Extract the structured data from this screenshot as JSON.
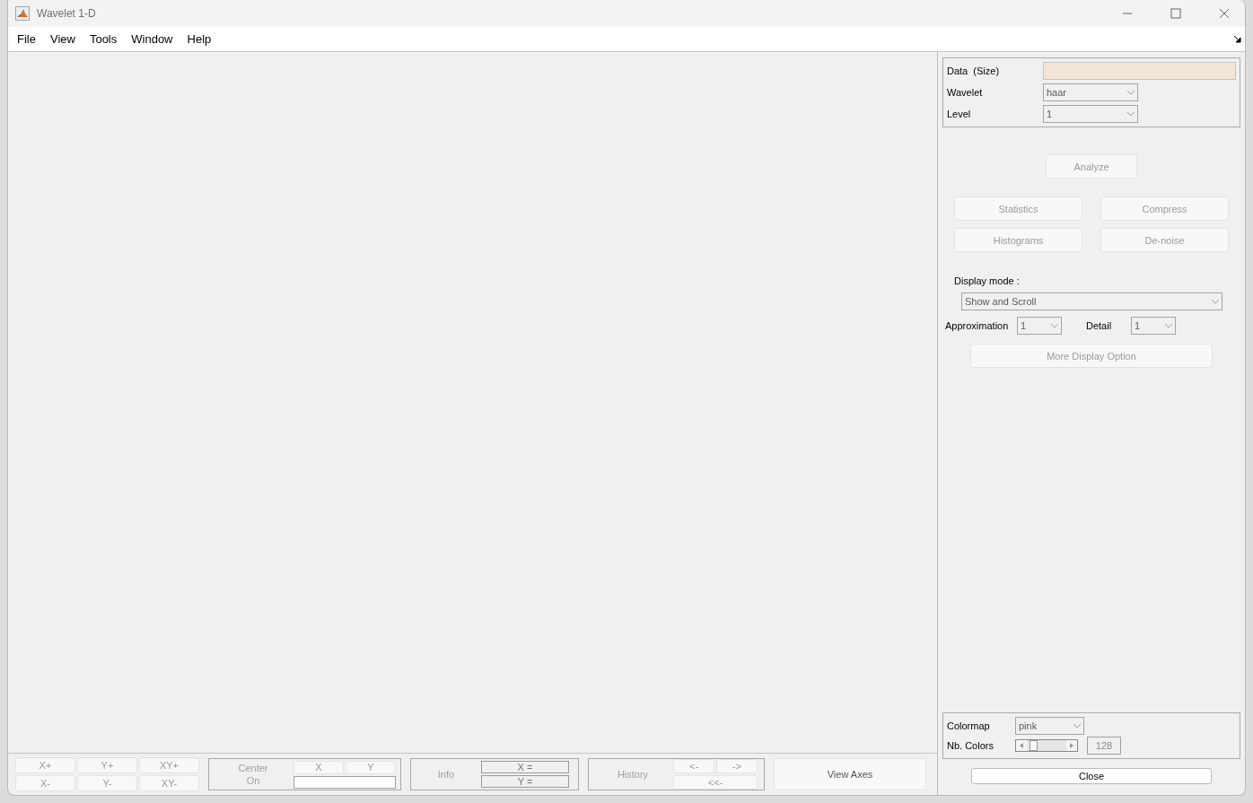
{
  "window": {
    "title": "Wavelet 1-D"
  },
  "menu": [
    "File",
    "View",
    "Tools",
    "Window",
    "Help"
  ],
  "params": {
    "data_label": "Data  (Size)",
    "wavelet_label": "Wavelet",
    "wavelet_value": "haar",
    "level_label": "Level",
    "level_value": "1"
  },
  "analyze": {
    "label": "Analyze",
    "disabled": true
  },
  "tools": [
    {
      "label": "Statistics",
      "disabled": true
    },
    {
      "label": "Compress",
      "disabled": true
    },
    {
      "label": "Histograms",
      "disabled": true
    },
    {
      "label": "De-noise",
      "disabled": true
    }
  ],
  "display": {
    "label": "Display mode :",
    "mode": "Show and Scroll",
    "approx_label": "Approximation",
    "approx_value": "1",
    "detail_label": "Detail",
    "detail_value": "1",
    "more": {
      "label": "More Display Option",
      "disabled": true
    }
  },
  "colormap": {
    "label": "Colormap",
    "value": "pink",
    "nb_label": "Nb. Colors",
    "level": 0.08,
    "count": "128"
  },
  "close": {
    "label": "Close",
    "disabled": false
  },
  "zoom_buttons": [
    {
      "label": "X+",
      "disabled": true
    },
    {
      "label": "Y+",
      "disabled": true
    },
    {
      "label": "XY+",
      "disabled": true
    },
    {
      "label": "X-",
      "disabled": true
    },
    {
      "label": "Y-",
      "disabled": true
    },
    {
      "label": "XY-",
      "disabled": true
    }
  ],
  "center": {
    "label_1": "Center",
    "label_2": "On",
    "x": "X",
    "y": "Y"
  },
  "info": {
    "label": "Info",
    "x": "X =",
    "y": "Y ="
  },
  "history": {
    "label": "History",
    "back": "<-",
    "forward": "->",
    "first": "<<-"
  },
  "view_axes": {
    "label": "View Axes",
    "disabled": false
  }
}
